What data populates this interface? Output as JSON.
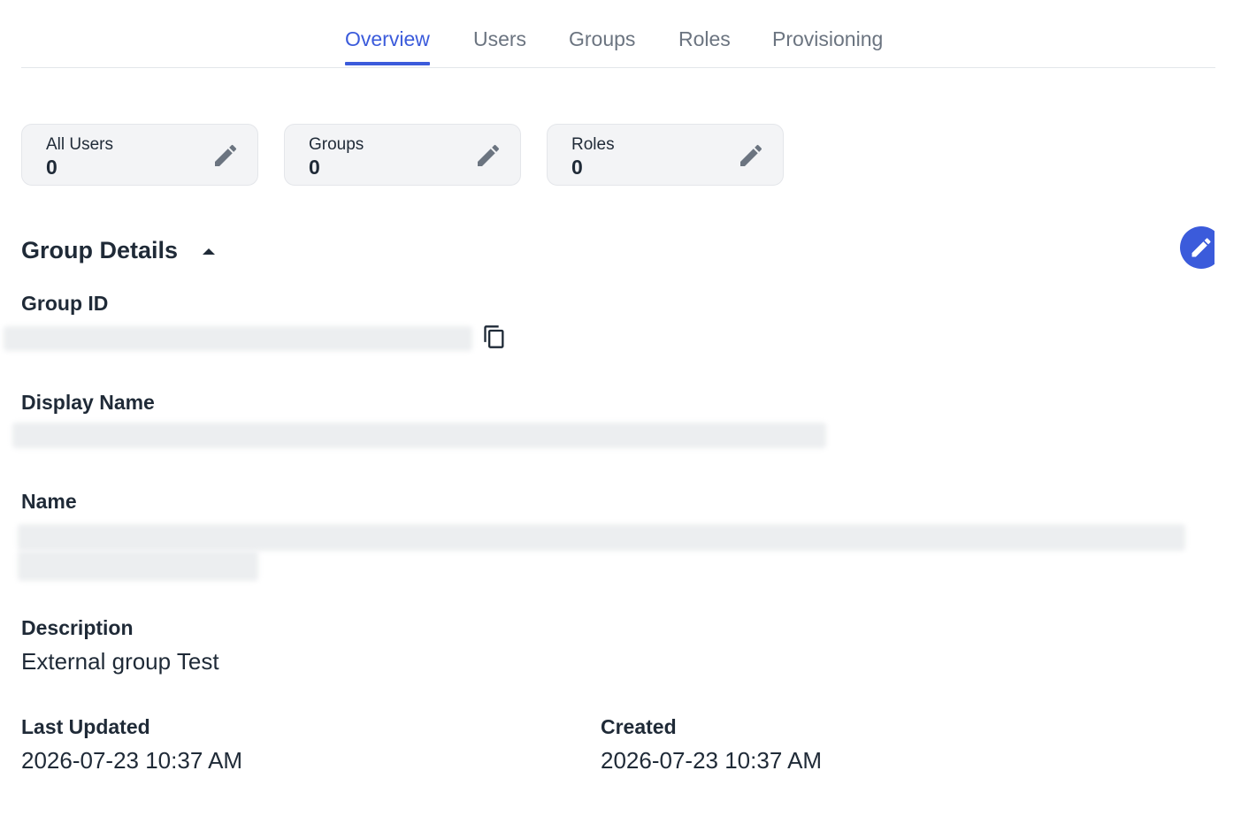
{
  "tabs": [
    {
      "label": "Overview",
      "active": true
    },
    {
      "label": "Users",
      "active": false
    },
    {
      "label": "Groups",
      "active": false
    },
    {
      "label": "Roles",
      "active": false
    },
    {
      "label": "Provisioning",
      "active": false
    }
  ],
  "stats": [
    {
      "label": "All Users",
      "value": "0",
      "icon": "pencil-icon"
    },
    {
      "label": "Groups",
      "value": "0",
      "icon": "pencil-icon"
    },
    {
      "label": "Roles",
      "value": "0",
      "icon": "pencil-icon"
    }
  ],
  "details": {
    "title": "Group Details",
    "toggle_icon": "caret-up-icon",
    "edit_icon": "pencil-icon",
    "group_id": {
      "label": "Group ID",
      "value": "",
      "copy_icon": "copy-icon"
    },
    "display_name": {
      "label": "Display Name",
      "value": ""
    },
    "name": {
      "label": "Name",
      "value": ""
    },
    "description": {
      "label": "Description",
      "value": "External group Test"
    },
    "last_updated": {
      "label": "Last Updated",
      "value": "2026-07-23 10:37 AM"
    },
    "created": {
      "label": "Created",
      "value": "2026-07-23 10:37 AM"
    }
  },
  "colors": {
    "accent": "#3b5bdb",
    "text": "#1f2a37",
    "muted": "#6b7480",
    "card_bg": "#f3f4f6"
  }
}
